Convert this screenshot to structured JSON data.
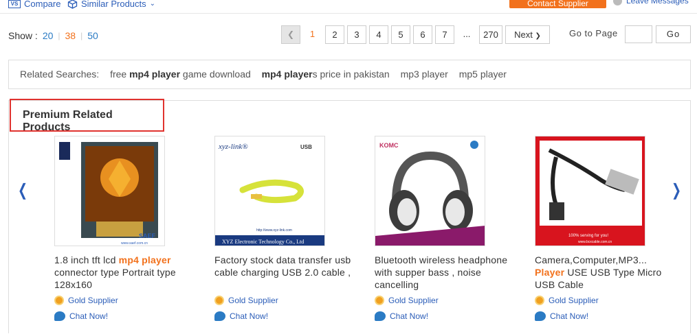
{
  "topbar": {
    "compare_label": "Compare",
    "compare_icon": "compare-icon",
    "similar_label": "Similar Products",
    "contact_label": "Contact Supplier",
    "leave_label": "Leave Messages"
  },
  "show": {
    "label": "Show :",
    "options": [
      "20",
      "38",
      "50"
    ],
    "active": "38"
  },
  "pagination": {
    "prev_icon": "chevron-left-icon",
    "pages": [
      "1",
      "2",
      "3",
      "4",
      "5",
      "6",
      "7"
    ],
    "current": "1",
    "ellipsis": "...",
    "last": "270",
    "next_label": "Next",
    "goto_label": "Go to Page",
    "go_label": "Go"
  },
  "related": {
    "label": "Related Searches:",
    "items": [
      {
        "pre": "free ",
        "bold": "mp4 player",
        "post": " game download"
      },
      {
        "pre": "",
        "bold": "mp4 player",
        "post": "s price in pakistan"
      },
      {
        "pre": "",
        "bold": "",
        "post": "mp3 player"
      },
      {
        "pre": "",
        "bold": "",
        "post": "mp5 player"
      }
    ]
  },
  "premium": {
    "title": "Premium Related Products",
    "products": [
      {
        "title_parts": [
          {
            "text": "1.8 inch tft lcd ",
            "hl": false
          },
          {
            "text": "mp4 player",
            "hl": true
          },
          {
            "text": " connector type Portrait type 128x160",
            "hl": false
          }
        ],
        "supplier": "Gold Supplier",
        "chat": "Chat Now!"
      },
      {
        "title_parts": [
          {
            "text": "Factory stock data transfer usb cable charging USB 2.0 cable ,",
            "hl": false
          }
        ],
        "supplier": "Gold Supplier",
        "chat": "Chat Now!"
      },
      {
        "title_parts": [
          {
            "text": "Bluetooth wireless headphone with supper bass , noise cancelling",
            "hl": false
          }
        ],
        "supplier": "Gold Supplier",
        "chat": "Chat Now!"
      },
      {
        "title_parts": [
          {
            "text": "Camera,Computer,MP3... ",
            "hl": false
          },
          {
            "text": "Player",
            "hl": true
          },
          {
            "text": " USE USB Type Micro USB Cable",
            "hl": false
          }
        ],
        "supplier": "Gold Supplier",
        "chat": "Chat Now!"
      }
    ],
    "image_text": {
      "lcd_brand": "SAEF",
      "lcd_url": "www.saef.com.cn",
      "usb_brand": "xyz-link®",
      "usb_tag": "USB",
      "usb_url": "http://www.xyz-link.com",
      "usb_company": "XYZ Electronic Technology Co., Ltd",
      "head_brand": "KOMC",
      "cable_slogan": "100% serving for you!",
      "cable_url": "www.bcxcable.com.cn"
    }
  }
}
